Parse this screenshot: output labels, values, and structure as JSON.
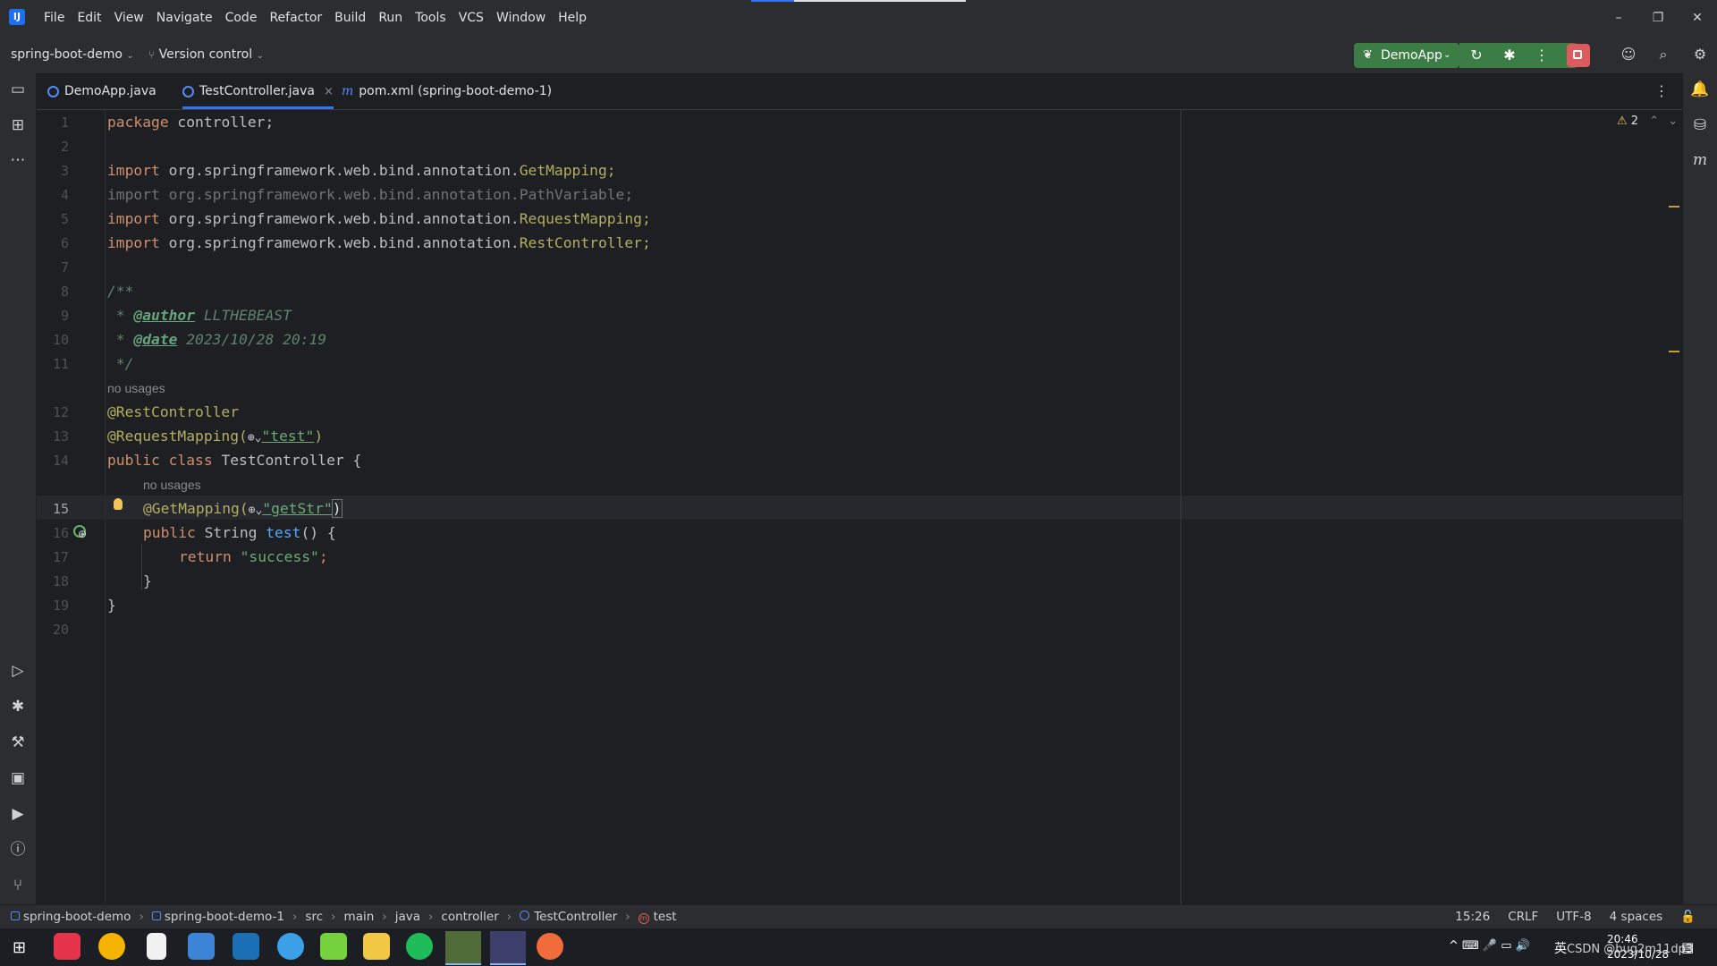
{
  "menu": [
    "File",
    "Edit",
    "View",
    "Navigate",
    "Code",
    "Refactor",
    "Build",
    "Run",
    "Tools",
    "VCS",
    "Window",
    "Help"
  ],
  "toolbar": {
    "project": "spring-boot-demo",
    "vcs": "Version control",
    "run_config": "DemoApp"
  },
  "tabs": [
    {
      "label": "DemoApp.java",
      "close": ""
    },
    {
      "label": "TestController.java",
      "close": "×"
    },
    {
      "label": "pom.xml (spring-boot-demo-1)",
      "close": ""
    }
  ],
  "editor": {
    "warnings_count": "2",
    "lines": [
      {
        "n": "1"
      },
      {
        "n": "2"
      },
      {
        "n": "3"
      },
      {
        "n": "4"
      },
      {
        "n": "5"
      },
      {
        "n": "6"
      },
      {
        "n": "7"
      },
      {
        "n": "8"
      },
      {
        "n": "9"
      },
      {
        "n": "10"
      },
      {
        "n": "11"
      },
      {
        "n": "12"
      },
      {
        "n": "13"
      },
      {
        "n": "14"
      },
      {
        "n": "15"
      },
      {
        "n": "16"
      },
      {
        "n": "17"
      },
      {
        "n": "18"
      },
      {
        "n": "19"
      },
      {
        "n": "20"
      }
    ],
    "code": {
      "l1_kw": "package",
      "l1_rest": " controller;",
      "l3_kw": "import",
      "l3_pkg": " org.springframework.web.bind.annotation.",
      "l3_cls": "GetMapping;",
      "l4": "import org.springframework.web.bind.annotation.PathVariable;",
      "l5_kw": "import",
      "l5_pkg": " org.springframework.web.bind.annotation.",
      "l5_cls": "RequestMapping;",
      "l6_kw": "import",
      "l6_pkg": " org.springframework.web.bind.annotation.",
      "l6_cls": "RestController;",
      "l8": "/**",
      "l9_pre": " * ",
      "l9_tag": "@author",
      "l9_val": " LLTHEBEAST",
      "l10_pre": " * ",
      "l10_tag": "@date",
      "l10_val": " 2023/10/28 20:19",
      "l11": " */",
      "hint_class": "no usages",
      "l12": "@RestController",
      "l13_ann": "@RequestMapping(",
      "l13_str": "\"test\"",
      "l13_end": ")",
      "l14_kw": "public class",
      "l14_rest": " TestController {",
      "hint_method": "no usages",
      "l15_ann": "@GetMapping(",
      "l15_str": "\"getStr\"",
      "l15_end": ")",
      "l16_kw": "public",
      "l16_type": " String ",
      "l16_fn": "test",
      "l16_rest": "() {",
      "l17_kw": "return",
      "l17_str": " \"success\"",
      "l17_end": ";",
      "l18": "}",
      "l19": "}"
    }
  },
  "statusbar": {
    "crumbs": [
      "spring-boot-demo",
      "spring-boot-demo-1",
      "src",
      "main",
      "java",
      "controller",
      "TestController",
      "test"
    ],
    "position": "15:26",
    "line_sep": "CRLF",
    "encoding": "UTF-8",
    "indent": "4 spaces"
  },
  "taskbar": {
    "time": "20:46",
    "date": "2023/10/28",
    "ime": "英",
    "watermark": "CSDN @bug2m11dp3"
  }
}
